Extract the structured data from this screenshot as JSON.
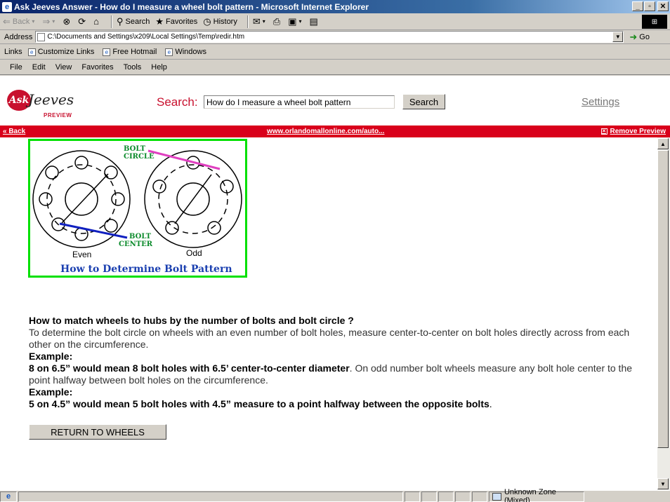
{
  "window": {
    "title": "Ask Jeeves Answer - How do I measure a wheel bolt pattern - Microsoft Internet Explorer",
    "min": "_",
    "max": "▫",
    "close": "✕"
  },
  "toolbar": {
    "back": "Back",
    "search": "Search",
    "favorites": "Favorites",
    "history": "History"
  },
  "address": {
    "label": "Address",
    "value": "C:\\Documents and Settings\\x209\\Local Settings\\Temp\\redir.htm",
    "go": "Go"
  },
  "links": {
    "label": "Links",
    "items": [
      "Customize Links",
      "Free Hotmail",
      "Windows"
    ]
  },
  "menu": [
    "File",
    "Edit",
    "View",
    "Favorites",
    "Tools",
    "Help"
  ],
  "jeeves": {
    "logo_ask": "Ask",
    "logo_jeeves": "Jeeves",
    "logo_preview": "PREVIEW",
    "search_label": "Search:",
    "search_value": "How do I measure a wheel bolt pattern",
    "search_button": "Search",
    "settings": "Settings"
  },
  "redbar": {
    "back": "« Back",
    "url": "www.orlandomallonline.com/auto...",
    "remove": "Remove Preview"
  },
  "diagram": {
    "bolt_circle_line1": "BOLT",
    "bolt_circle_line2": "CIRCLE",
    "bolt_center_line1": "BOLT",
    "bolt_center_line2": "CENTER",
    "even": "Even",
    "odd": "Odd",
    "caption": "How to Determine Bolt Pattern",
    "colors": {
      "border": "#00e000",
      "pink": "#e040c0",
      "blue": "#1020c0",
      "green_text": "#0a8a2a",
      "caption": "#1a3fb0"
    }
  },
  "article": {
    "heading": "How to match wheels to hubs by the number of bolts and bolt circle ?",
    "para1": "To determine the bolt circle on wheels with an even number of bolt holes, measure center-to-center on bolt holes directly across from each other on the circumference.",
    "example_label_1": "Example:",
    "example1_bold": "8 on 6.5” would mean 8 bolt holes with 6.5’ center-to-center diameter",
    "example1_rest": ".  On odd number bolt wheels measure any bolt hole center to the point halfway between bolt holes on the circumference.",
    "example_label_2": "Example:",
    "example2_bold": "5 on 4.5” would mean 5 bolt holes with 4.5” measure to a point halfway between the opposite bolts",
    "example2_rest": ".",
    "return_button": "RETURN TO WHEELS"
  },
  "status": {
    "zone": "Unknown Zone (Mixed)"
  }
}
